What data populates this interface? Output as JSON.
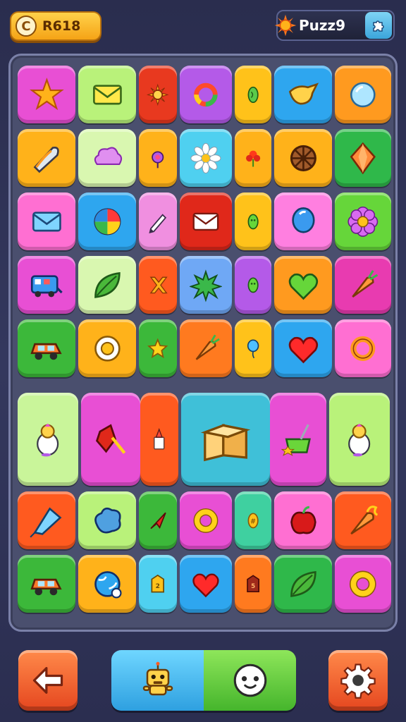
{
  "header": {
    "score_label": "R618",
    "score_icon": "coin-icon",
    "level_label": "Puzz9",
    "level_icon": "sun-icon",
    "level_button_icon": "puzzle-piece-icon"
  },
  "board": {
    "rows": 8,
    "tiles": [
      {
        "icon": "star",
        "color": "#e84fd4"
      },
      {
        "icon": "envelope",
        "color": "#b9f27a"
      },
      {
        "icon": "sun",
        "color": "#e8391f"
      },
      {
        "icon": "ring",
        "color": "#b45ae8"
      },
      {
        "icon": "bean",
        "color": "#ffc21a"
      },
      {
        "icon": "bird",
        "color": "#2ea6ef"
      },
      {
        "icon": "bubble",
        "color": "#ff9a1f"
      },
      {
        "icon": "leaf-pen",
        "color": "#ffb21a"
      },
      {
        "icon": "cloud",
        "color": "#d9f7b0"
      },
      {
        "icon": "lollipop",
        "color": "#ffb21a"
      },
      {
        "icon": "daisy",
        "color": "#4fd0f0"
      },
      {
        "icon": "flower-red",
        "color": "#ffb21a"
      },
      {
        "icon": "wheel",
        "color": "#ffb21a"
      },
      {
        "icon": "gem",
        "color": "#2fb84a"
      },
      {
        "icon": "envelope-blue",
        "color": "#ff6fd2"
      },
      {
        "icon": "beach-ball",
        "color": "#2ea6ef"
      },
      {
        "icon": "pencil",
        "color": "#f08fe0"
      },
      {
        "icon": "envelope-red",
        "color": "#e0281a"
      },
      {
        "icon": "bean-green",
        "color": "#ffc21a"
      },
      {
        "icon": "balloon",
        "color": "#ff7fe0"
      },
      {
        "icon": "flower-pink",
        "color": "#66d63a"
      },
      {
        "icon": "bus",
        "color": "#e84fd4"
      },
      {
        "icon": "leaf",
        "color": "#d9f7b0"
      },
      {
        "icon": "x-mark",
        "color": "#ff5a1f"
      },
      {
        "icon": "splat",
        "color": "#6fa8f5"
      },
      {
        "icon": "bean-green",
        "color": "#b45ae8"
      },
      {
        "icon": "heart-green",
        "color": "#ff9a1f"
      },
      {
        "icon": "carrot",
        "color": "#e83bb0"
      },
      {
        "icon": "car",
        "color": "#3cb83a"
      },
      {
        "icon": "donut",
        "color": "#ffb21a"
      },
      {
        "icon": "star-yellow",
        "color": "#3cb83a"
      },
      {
        "icon": "carrot",
        "color": "#ff7a1f"
      },
      {
        "icon": "balloon-drop",
        "color": "#ffc21a"
      },
      {
        "icon": "heart",
        "color": "#2ea6ef"
      },
      {
        "icon": "ring-orange",
        "color": "#ff6fd2"
      },
      {
        "icon": "chick",
        "color": "#c9f59a"
      },
      {
        "icon": "crystal-hammer",
        "color": "#e84fd4"
      },
      {
        "icon": "glue",
        "color": "#ff5a1f"
      },
      {
        "icon": "boxes",
        "color": "#3fc0d8"
      },
      {
        "icon": "pot",
        "color": "#e84fd4"
      },
      {
        "icon": "chick",
        "color": "#b9f27a"
      },
      {
        "icon": "kite",
        "color": "#ff5a1f"
      },
      {
        "icon": "blob",
        "color": "#b9f27a"
      },
      {
        "icon": "arrow",
        "color": "#3cb83a"
      },
      {
        "icon": "ring-yellow",
        "color": "#e84fd4"
      },
      {
        "icon": "seed",
        "color": "#3fd0a0"
      },
      {
        "icon": "apple",
        "color": "#ff6fd2"
      },
      {
        "icon": "carrot-flame",
        "color": "#ff5a1f"
      },
      {
        "icon": "car",
        "color": "#3cb83a"
      },
      {
        "icon": "globe",
        "color": "#ffb21a"
      },
      {
        "icon": "tag",
        "color": "#4fd0f0"
      },
      {
        "icon": "heart",
        "color": "#2ea6ef"
      },
      {
        "icon": "tag-red",
        "color": "#ff7a1f"
      },
      {
        "icon": "leaf",
        "color": "#2fb84a"
      },
      {
        "icon": "ring-yellow",
        "color": "#e84fd4"
      }
    ]
  },
  "footer": {
    "back_icon": "back-arrow-icon",
    "character_icon": "robot-character-icon",
    "face_icon": "smiley-face-icon",
    "settings_icon": "gear-icon"
  }
}
